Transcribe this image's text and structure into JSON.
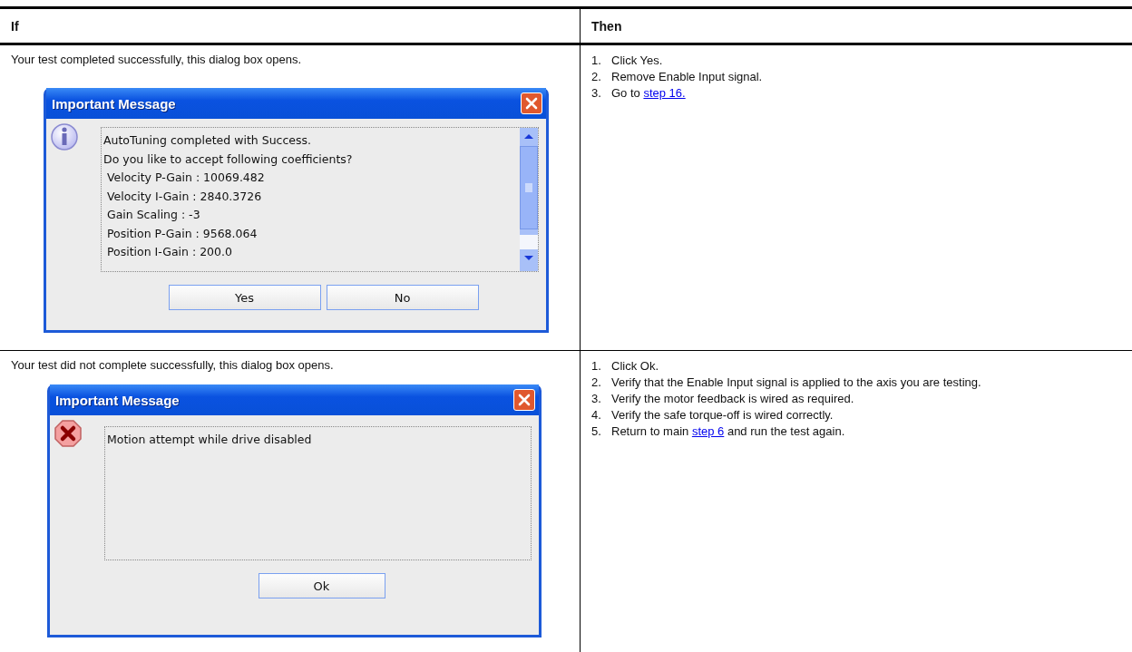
{
  "table": {
    "columns": [
      "If",
      "Then"
    ],
    "rows": [
      {
        "condition": "Your test completed successfully, this dialog box opens.",
        "dialog": {
          "title": "Important Message",
          "kind": "info",
          "has_scrollbar": true,
          "message_lines": [
            "AutoTuning completed with Success.",
            "Do you like to accept following coefficients?",
            " Velocity P-Gain : 10069.482",
            " Velocity I-Gain : 2840.3726",
            " Gain Scaling : -3",
            " Position P-Gain : 9568.064",
            " Position I-Gain : 200.0"
          ],
          "buttons": [
            "Yes",
            "No"
          ]
        },
        "steps": [
          {
            "number": "1.",
            "parts": [
              {
                "kind": "text",
                "text": "Click Yes."
              }
            ]
          },
          {
            "number": "2.",
            "parts": [
              {
                "kind": "text",
                "text": "Remove Enable Input signal."
              }
            ]
          },
          {
            "number": "3.",
            "parts": [
              {
                "kind": "text",
                "text": "Go to "
              },
              {
                "kind": "link",
                "text": "step 16."
              }
            ]
          }
        ]
      },
      {
        "condition": "Your test did not complete successfully, this dialog box opens.",
        "dialog": {
          "title": "Important Message",
          "kind": "error",
          "has_scrollbar": false,
          "message_lines": [
            "Motion attempt while drive disabled"
          ],
          "buttons": [
            "Ok"
          ]
        },
        "steps": [
          {
            "number": "1.",
            "parts": [
              {
                "kind": "text",
                "text": "Click Ok."
              }
            ]
          },
          {
            "number": "2.",
            "parts": [
              {
                "kind": "text",
                "text": "Verify that the Enable Input signal is applied to the axis you are testing."
              }
            ]
          },
          {
            "number": "3.",
            "parts": [
              {
                "kind": "text",
                "text": "Verify the motor feedback is wired as required."
              }
            ]
          },
          {
            "number": "4.",
            "parts": [
              {
                "kind": "text",
                "text": "Verify the safe torque-off is wired correctly."
              }
            ]
          },
          {
            "number": "5.",
            "parts": [
              {
                "kind": "text",
                "text": "Return to main "
              },
              {
                "kind": "link",
                "text": "step 6"
              },
              {
                "kind": "text",
                "text": " and run the test again."
              }
            ]
          }
        ]
      }
    ]
  }
}
